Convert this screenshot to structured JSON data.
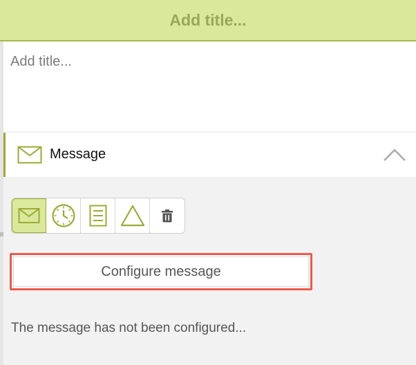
{
  "header": {
    "title": "Add title..."
  },
  "title_area": {
    "placeholder": "Add title..."
  },
  "message_section": {
    "label": "Message",
    "icon": "envelope-icon",
    "expand_icon": "chevron-up-icon"
  },
  "toolbar": {
    "tools": [
      {
        "name": "message",
        "icon": "envelope-icon",
        "active": true
      },
      {
        "name": "timer",
        "icon": "clock-icon",
        "active": false
      },
      {
        "name": "document",
        "icon": "document-icon",
        "active": false
      },
      {
        "name": "warning",
        "icon": "triangle-icon",
        "active": false
      },
      {
        "name": "delete",
        "icon": "trash-icon",
        "active": false
      }
    ]
  },
  "configure_button": {
    "label": "Configure message"
  },
  "status": {
    "text": "The message has not been configured..."
  },
  "colors": {
    "accent": "#9daa34",
    "header_bg": "#d9e89a",
    "highlight_border": "#f0584a"
  }
}
